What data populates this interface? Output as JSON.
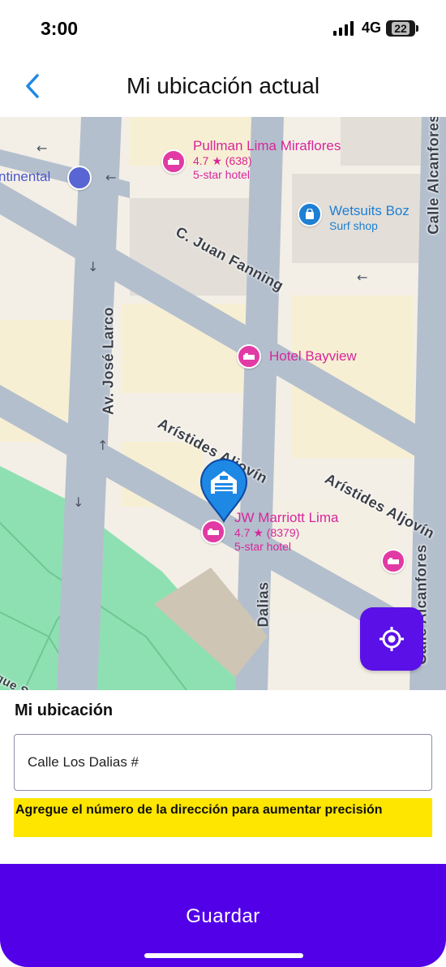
{
  "status_bar": {
    "time": "3:00",
    "network": "4G",
    "battery": "22"
  },
  "header": {
    "title": "Mi ubicación actual",
    "back_icon": "chevron-left-icon"
  },
  "map": {
    "pois": [
      {
        "name": "Pullman Lima Miraflores",
        "rating": "4.7 ★ (638)",
        "type": "5-star hotel"
      },
      {
        "name": "Wetsuits Boz",
        "type": "Surf shop"
      },
      {
        "name": "Hotel Bayview"
      },
      {
        "name": "JW Marriott Lima",
        "rating": "4.7 ★ (8379)",
        "type": "5-star hotel"
      },
      {
        "name": "ntinental"
      }
    ],
    "streets": {
      "juan_fanning": "C. Juan Fanning",
      "jose_larco": "Av. José Larco",
      "aljovin_1": "Arístides Aljovín",
      "aljovin_2": "Arístides Aljovín",
      "alcanfores_1": "Calle Alcanfores",
      "alcanfores_2": "Calle Alcanfores",
      "dalias": "Dalias",
      "salazar": "rque Salazar"
    },
    "locate_icon": "crosshair-icon",
    "pin_icon": "location-pin-icon"
  },
  "form": {
    "label": "Mi ubicación",
    "address_value": "Calle Los Dalias #",
    "warning": "Agregue el número de la dirección para aumentar precisión"
  },
  "actions": {
    "save_label": "Guardar"
  },
  "colors": {
    "accent": "#5200e8",
    "back": "#1e88e5",
    "warning_bg": "#ffe600",
    "poi": "#d6279a",
    "poi_blue": "#1e7fd4"
  }
}
